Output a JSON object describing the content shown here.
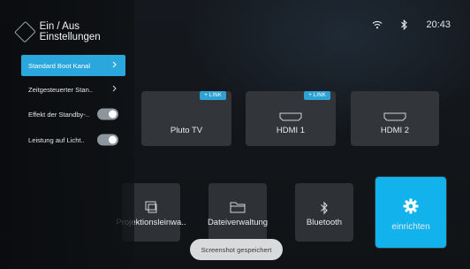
{
  "status_bar": {
    "wifi_icon": "wifi-icon",
    "bluetooth_icon": "bluetooth-icon",
    "time": "20:43"
  },
  "panel": {
    "title": "Ein / Aus Einstellungen",
    "items": [
      {
        "label": "Standard Boot Kanal",
        "type": "submenu",
        "selected": true
      },
      {
        "label": "Zeitgesteuerter Stan..",
        "type": "submenu",
        "selected": false
      },
      {
        "label": "Effekt der Standby-..",
        "type": "toggle",
        "on": true
      },
      {
        "label": "Leistung auf Licht..",
        "type": "toggle",
        "on": true
      }
    ]
  },
  "sources": [
    {
      "label": "Pluto TV",
      "badge": "+ LINK"
    },
    {
      "label": "HDMI 1",
      "badge": "+ LINK"
    },
    {
      "label": "HDMI 2",
      "badge": ""
    }
  ],
  "apps": [
    {
      "label": "Projektionsleinwa..",
      "icon": "cast-icon"
    },
    {
      "label": "Dateiverwaltung",
      "icon": "folder-icon"
    },
    {
      "label": "Bluetooth",
      "icon": "bluetooth-icon"
    },
    {
      "label": "einrichten",
      "icon": "settings-gear-icon",
      "active": true
    }
  ],
  "toast": "Screenshot gespeichert",
  "colors": {
    "accent": "#2aa7dd",
    "active_tile": "#12b3ec",
    "badge": "#2ea2d3"
  }
}
